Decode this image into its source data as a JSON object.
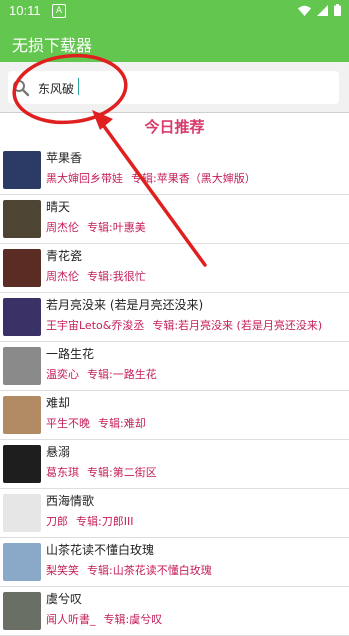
{
  "status": {
    "time": "10:11",
    "a_icon": "A"
  },
  "appbar": {
    "title": "无损下载器"
  },
  "search": {
    "value": "东风破"
  },
  "section": {
    "title": "今日推荐"
  },
  "songs": [
    {
      "title": "苹果香",
      "artist": "黑大婶回乡带娃",
      "album": "专辑:苹果香（黑大婶版）",
      "color": "#2c3a66"
    },
    {
      "title": "晴天",
      "artist": "周杰伦",
      "album": "专辑:叶惠美",
      "color": "#4d4433"
    },
    {
      "title": "青花瓷",
      "artist": "周杰伦",
      "album": "专辑:我很忙",
      "color": "#5a2c24"
    },
    {
      "title": "若月亮没来 (若是月亮还没来)",
      "artist": "王宇宙Leto&乔浚丞",
      "album": "专辑:若月亮没来 (若是月亮还没来)",
      "color": "#3a3266"
    },
    {
      "title": "一路生花",
      "artist": "温奕心",
      "album": "专辑:一路生花",
      "color": "#8a8a8a"
    },
    {
      "title": "难却",
      "artist": "平生不晚",
      "album": "专辑:难却",
      "color": "#b28a63"
    },
    {
      "title": "悬溺",
      "artist": "葛东琪",
      "album": "专辑:第二街区",
      "color": "#1e1e1e"
    },
    {
      "title": "西海情歌",
      "artist": "刀郎",
      "album": "专辑:刀郎III",
      "color": "#e6e6e6"
    },
    {
      "title": "山茶花读不懂白玫瑰",
      "artist": "梨笑笑",
      "album": "专辑:山茶花读不懂白玫瑰",
      "color": "#8aa8c8"
    },
    {
      "title": "虞兮叹",
      "artist": "闻人听書_",
      "album": "专辑:虞兮叹",
      "color": "#6a6f66"
    }
  ]
}
